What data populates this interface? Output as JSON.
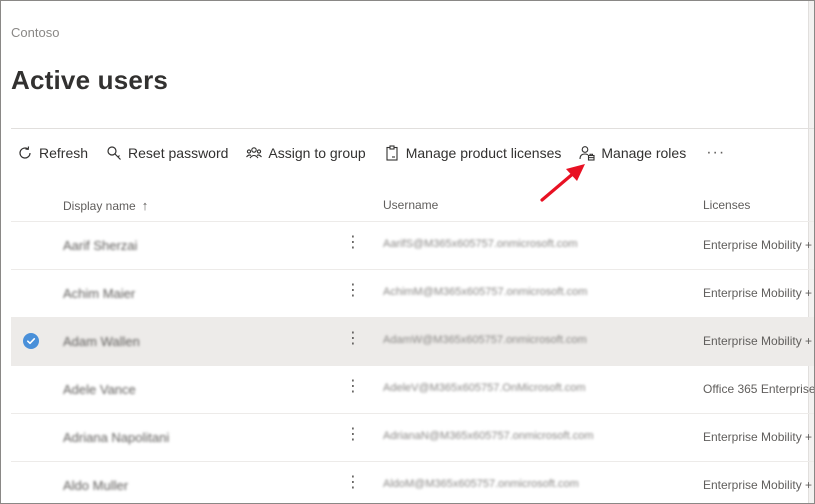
{
  "org_name": "Contoso",
  "page_title": "Active users",
  "toolbar": {
    "refresh": "Refresh",
    "reset_password": "Reset password",
    "assign_to_group": "Assign to group",
    "manage_licenses": "Manage product licenses",
    "manage_roles": "Manage roles",
    "more": "···"
  },
  "columns": {
    "display_name": "Display name",
    "sort_arrow": "↑",
    "username": "Username",
    "licenses": "Licenses"
  },
  "rows": [
    {
      "name": "Aarif Sherzai",
      "username": "AarifS@M365x605757.onmicrosoft.com",
      "license": "Enterprise Mobility +",
      "selected": false
    },
    {
      "name": "Achim Maier",
      "username": "AchimM@M365x605757.onmicrosoft.com",
      "license": "Enterprise Mobility +",
      "selected": false
    },
    {
      "name": "Adam Wallen",
      "username": "AdamW@M365x605757.onmicrosoft.com",
      "license": "Enterprise Mobility +",
      "selected": true
    },
    {
      "name": "Adele Vance",
      "username": "AdeleV@M365x605757.OnMicrosoft.com",
      "license": "Office 365 Enterprise",
      "selected": false
    },
    {
      "name": "Adriana Napolitani",
      "username": "AdrianaN@M365x605757.onmicrosoft.com",
      "license": "Enterprise Mobility +",
      "selected": false
    },
    {
      "name": "Aldo Muller",
      "username": "AldoM@M365x605757.onmicrosoft.com",
      "license": "Enterprise Mobility +",
      "selected": false
    }
  ],
  "row_menu_glyph": "⋮",
  "colors": {
    "accent": "#4a90d9",
    "annotation_arrow": "#e81123",
    "selected_row": "#edebe9"
  }
}
